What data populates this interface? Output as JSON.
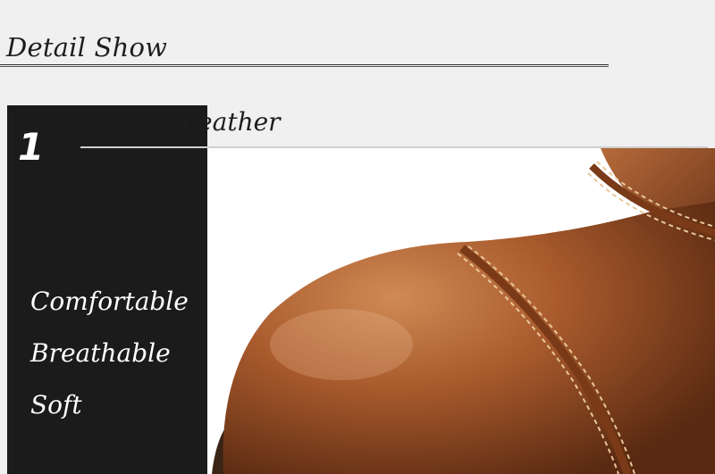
{
  "header": {
    "section_title": "Detail Show"
  },
  "feature": {
    "number": "1",
    "title": "Genuine Leather",
    "attributes": [
      "Comfortable",
      "Breathable",
      "Soft"
    ]
  },
  "photo": {
    "icon": "leather-boot-toe-icon"
  },
  "colors": {
    "background": "#f0f0f0",
    "panel": "#1b1b1b",
    "leather": "#a0542a",
    "stitch": "#e9c79a"
  }
}
